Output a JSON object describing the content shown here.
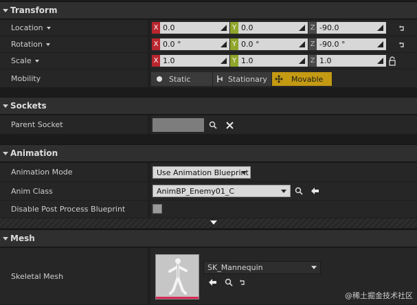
{
  "transform": {
    "title": "Transform",
    "location": {
      "label": "Location",
      "x": "0.0",
      "y": "0.0",
      "z": "-90.0"
    },
    "rotation": {
      "label": "Rotation",
      "x": "0.0 °",
      "y": "0.0 °",
      "z": "-90.0 °"
    },
    "scale": {
      "label": "Scale",
      "x": "1.0",
      "y": "1.0",
      "z": "1.0"
    },
    "axis_labels": {
      "x": "X",
      "y": "Y",
      "z": "Z"
    },
    "mobility": {
      "label": "Mobility",
      "options": [
        "Static",
        "Stationary",
        "Movable"
      ],
      "selected": "Movable"
    }
  },
  "sockets": {
    "title": "Sockets",
    "parent_socket_label": "Parent Socket"
  },
  "animation": {
    "title": "Animation",
    "mode_label": "Animation Mode",
    "mode_value": "Use Animation Blueprint",
    "anim_class_label": "Anim Class",
    "anim_class_value": "AnimBP_Enemy01_C",
    "disable_pp_label": "Disable Post Process Blueprint",
    "disable_pp_checked": false
  },
  "mesh": {
    "title": "Mesh",
    "skeletal_mesh_label": "Skeletal Mesh",
    "skeletal_mesh_value": "SK_Mannequin"
  },
  "colors": {
    "x_axis": "#b8262e",
    "y_axis": "#8fa62c",
    "z_axis": "#4a4a4a",
    "movable_active": "#c49a13",
    "thumb_accent": "#d92a55"
  },
  "watermark": "@稀土掘金技术社区"
}
